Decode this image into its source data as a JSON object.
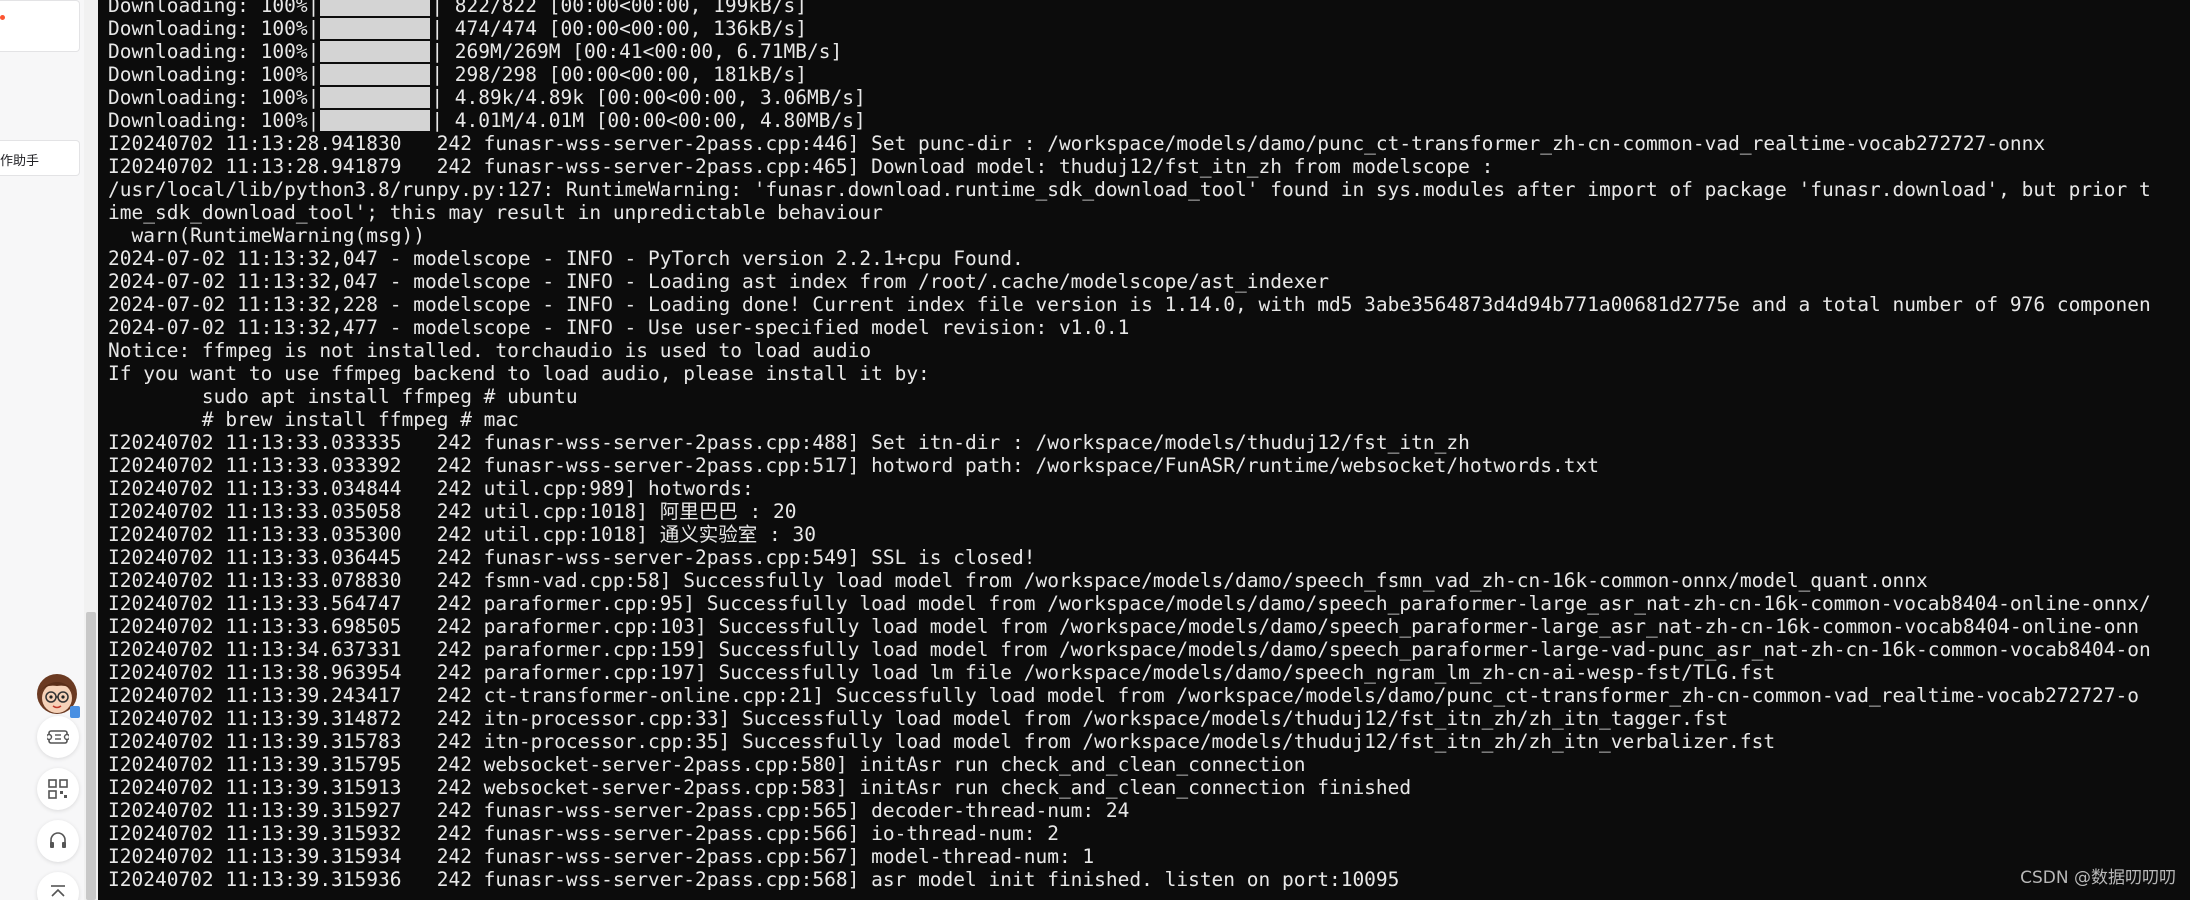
{
  "sidebar": {
    "partial_label": "作助手",
    "tools": [
      {
        "name": "mascot-icon"
      },
      {
        "name": "ticket-icon"
      },
      {
        "name": "qrcode-icon"
      },
      {
        "name": "headset-icon"
      },
      {
        "name": "to-top-icon"
      }
    ]
  },
  "terminal": {
    "lines": [
      {
        "type": "progress",
        "prefix": "Downloading: 100%|",
        "suffix": "| 822/822 [00:00<00:00, 199kB/s]"
      },
      {
        "type": "progress",
        "prefix": "Downloading: 100%|",
        "suffix": "| 474/474 [00:00<00:00, 136kB/s]"
      },
      {
        "type": "progress",
        "prefix": "Downloading: 100%|",
        "suffix": "| 269M/269M [00:41<00:00, 6.71MB/s]"
      },
      {
        "type": "progress",
        "prefix": "Downloading: 100%|",
        "suffix": "| 298/298 [00:00<00:00, 181kB/s]"
      },
      {
        "type": "progress",
        "prefix": "Downloading: 100%|",
        "suffix": "| 4.89k/4.89k [00:00<00:00, 3.06MB/s]"
      },
      {
        "type": "progress",
        "prefix": "Downloading: 100%|",
        "suffix": "| 4.01M/4.01M [00:00<00:00, 4.80MB/s]"
      },
      {
        "type": "text",
        "text": "I20240702 11:13:28.941830   242 funasr-wss-server-2pass.cpp:446] Set punc-dir : /workspace/models/damo/punc_ct-transformer_zh-cn-common-vad_realtime-vocab272727-onnx"
      },
      {
        "type": "text",
        "text": "I20240702 11:13:28.941879   242 funasr-wss-server-2pass.cpp:465] Download model: thuduj12/fst_itn_zh from modelscope :"
      },
      {
        "type": "text",
        "text": "/usr/local/lib/python3.8/runpy.py:127: RuntimeWarning: 'funasr.download.runtime_sdk_download_tool' found in sys.modules after import of package 'funasr.download', but prior t"
      },
      {
        "type": "text",
        "text": "ime_sdk_download_tool'; this may result in unpredictable behaviour"
      },
      {
        "type": "text",
        "text": "  warn(RuntimeWarning(msg))"
      },
      {
        "type": "text",
        "text": "2024-07-02 11:13:32,047 - modelscope - INFO - PyTorch version 2.2.1+cpu Found."
      },
      {
        "type": "text",
        "text": "2024-07-02 11:13:32,047 - modelscope - INFO - Loading ast index from /root/.cache/modelscope/ast_indexer"
      },
      {
        "type": "text",
        "text": "2024-07-02 11:13:32,228 - modelscope - INFO - Loading done! Current index file version is 1.14.0, with md5 3abe3564873d4d94b771a00681d2775e and a total number of 976 componen"
      },
      {
        "type": "text",
        "text": "2024-07-02 11:13:32,477 - modelscope - INFO - Use user-specified model revision: v1.0.1"
      },
      {
        "type": "text",
        "text": "Notice: ffmpeg is not installed. torchaudio is used to load audio"
      },
      {
        "type": "text",
        "text": "If you want to use ffmpeg backend to load audio, please install it by:"
      },
      {
        "type": "text",
        "text": "        sudo apt install ffmpeg # ubuntu"
      },
      {
        "type": "text",
        "text": "        # brew install ffmpeg # mac"
      },
      {
        "type": "text",
        "text": "I20240702 11:13:33.033335   242 funasr-wss-server-2pass.cpp:488] Set itn-dir : /workspace/models/thuduj12/fst_itn_zh"
      },
      {
        "type": "text",
        "text": "I20240702 11:13:33.033392   242 funasr-wss-server-2pass.cpp:517] hotword path: /workspace/FunASR/runtime/websocket/hotwords.txt"
      },
      {
        "type": "text",
        "text": "I20240702 11:13:33.034844   242 util.cpp:989] hotwords:"
      },
      {
        "type": "text",
        "text": "I20240702 11:13:33.035058   242 util.cpp:1018] 阿里巴巴 : 20"
      },
      {
        "type": "text",
        "text": "I20240702 11:13:33.035300   242 util.cpp:1018] 通义实验室 : 30"
      },
      {
        "type": "text",
        "text": "I20240702 11:13:33.036445   242 funasr-wss-server-2pass.cpp:549] SSL is closed!"
      },
      {
        "type": "text",
        "text": "I20240702 11:13:33.078830   242 fsmn-vad.cpp:58] Successfully load model from /workspace/models/damo/speech_fsmn_vad_zh-cn-16k-common-onnx/model_quant.onnx"
      },
      {
        "type": "text",
        "text": "I20240702 11:13:33.564747   242 paraformer.cpp:95] Successfully load model from /workspace/models/damo/speech_paraformer-large_asr_nat-zh-cn-16k-common-vocab8404-online-onnx/"
      },
      {
        "type": "text",
        "text": "I20240702 11:13:33.698505   242 paraformer.cpp:103] Successfully load model from /workspace/models/damo/speech_paraformer-large_asr_nat-zh-cn-16k-common-vocab8404-online-onn"
      },
      {
        "type": "text",
        "text": "I20240702 11:13:34.637331   242 paraformer.cpp:159] Successfully load model from /workspace/models/damo/speech_paraformer-large-vad-punc_asr_nat-zh-cn-16k-common-vocab8404-on"
      },
      {
        "type": "text",
        "text": "I20240702 11:13:38.963954   242 paraformer.cpp:197] Successfully load lm file /workspace/models/damo/speech_ngram_lm_zh-cn-ai-wesp-fst/TLG.fst"
      },
      {
        "type": "text",
        "text": "I20240702 11:13:39.243417   242 ct-transformer-online.cpp:21] Successfully load model from /workspace/models/damo/punc_ct-transformer_zh-cn-common-vad_realtime-vocab272727-o"
      },
      {
        "type": "text",
        "text": "I20240702 11:13:39.314872   242 itn-processor.cpp:33] Successfully load model from /workspace/models/thuduj12/fst_itn_zh/zh_itn_tagger.fst"
      },
      {
        "type": "text",
        "text": "I20240702 11:13:39.315783   242 itn-processor.cpp:35] Successfully load model from /workspace/models/thuduj12/fst_itn_zh/zh_itn_verbalizer.fst"
      },
      {
        "type": "text",
        "text": "I20240702 11:13:39.315795   242 websocket-server-2pass.cpp:580] initAsr run check_and_clean_connection"
      },
      {
        "type": "text",
        "text": "I20240702 11:13:39.315913   242 websocket-server-2pass.cpp:583] initAsr run check_and_clean_connection finished"
      },
      {
        "type": "text",
        "text": "I20240702 11:13:39.315927   242 funasr-wss-server-2pass.cpp:565] decoder-thread-num: 24"
      },
      {
        "type": "text",
        "text": "I20240702 11:13:39.315932   242 funasr-wss-server-2pass.cpp:566] io-thread-num: 2"
      },
      {
        "type": "text",
        "text": "I20240702 11:13:39.315934   242 funasr-wss-server-2pass.cpp:567] model-thread-num: 1"
      },
      {
        "type": "text",
        "text": "I20240702 11:13:39.315936   242 funasr-wss-server-2pass.cpp:568] asr model init finished. listen on port:10095"
      }
    ]
  },
  "watermark": "CSDN @数据叨叨叨",
  "colors": {
    "terminal_bg": "#0c0c0c",
    "terminal_fg": "#e8e8e8",
    "progress_fill": "#d4d4d4",
    "notify_dot": "#fc5531"
  }
}
